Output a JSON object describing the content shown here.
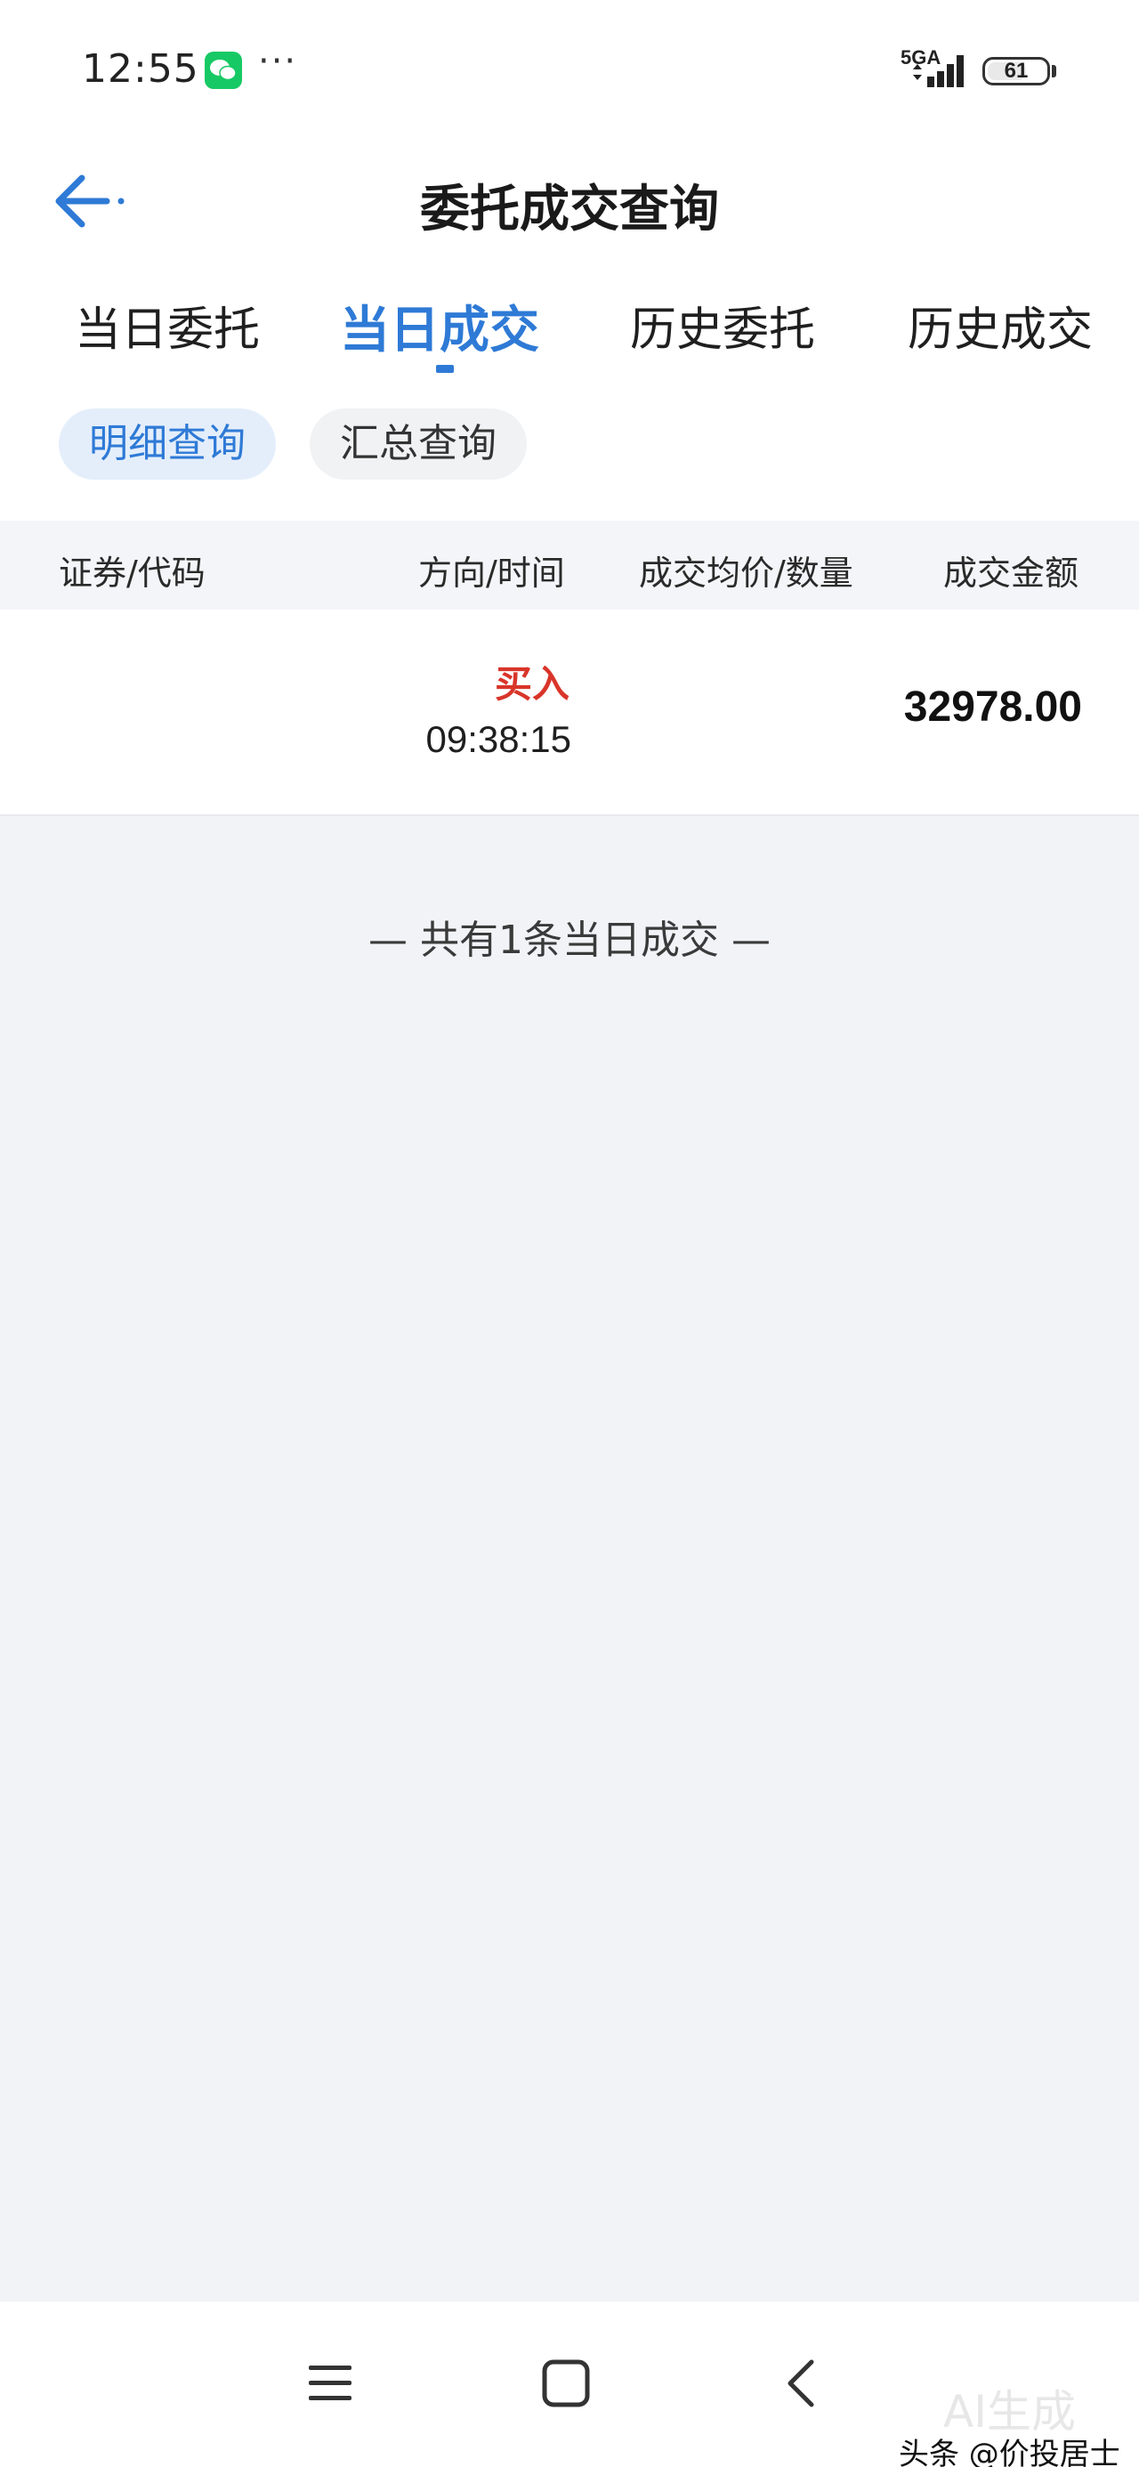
{
  "status_bar": {
    "time": "12:55",
    "network": "5GA",
    "battery": "61",
    "battery_level": 0.61,
    "more": "···",
    "icons": [
      "wechat-icon",
      "signal-icon",
      "battery-icon"
    ]
  },
  "header": {
    "title": "委托成交查询",
    "back_icon": "arrow-left-icon"
  },
  "tabs": [
    {
      "label": "当日委托",
      "active": false
    },
    {
      "label": "当日成交",
      "active": true
    },
    {
      "label": "历史委托",
      "active": false
    },
    {
      "label": "历史成交",
      "active": false
    }
  ],
  "subtabs": [
    {
      "label": "明细查询",
      "active": true
    },
    {
      "label": "汇总查询",
      "active": false
    }
  ],
  "table": {
    "columns": [
      "证券/代码",
      "方向/时间",
      "成交均价/数量",
      "成交金额"
    ],
    "rows": [
      {
        "security": "",
        "direction": "买入",
        "time": "09:38:15",
        "price_qty": "",
        "amount": "32978.00"
      }
    ]
  },
  "summary": "—  共有1条当日成交  —",
  "bottom_nav": {
    "icons": [
      "menu-icon",
      "home-icon",
      "back-icon"
    ]
  },
  "watermark": {
    "text": "头条 @价投居士",
    "ai_label": "AI生成"
  },
  "colors": {
    "accent": "#2e7ad6",
    "buy": "#d9352a",
    "background": "#f1f3f7"
  }
}
